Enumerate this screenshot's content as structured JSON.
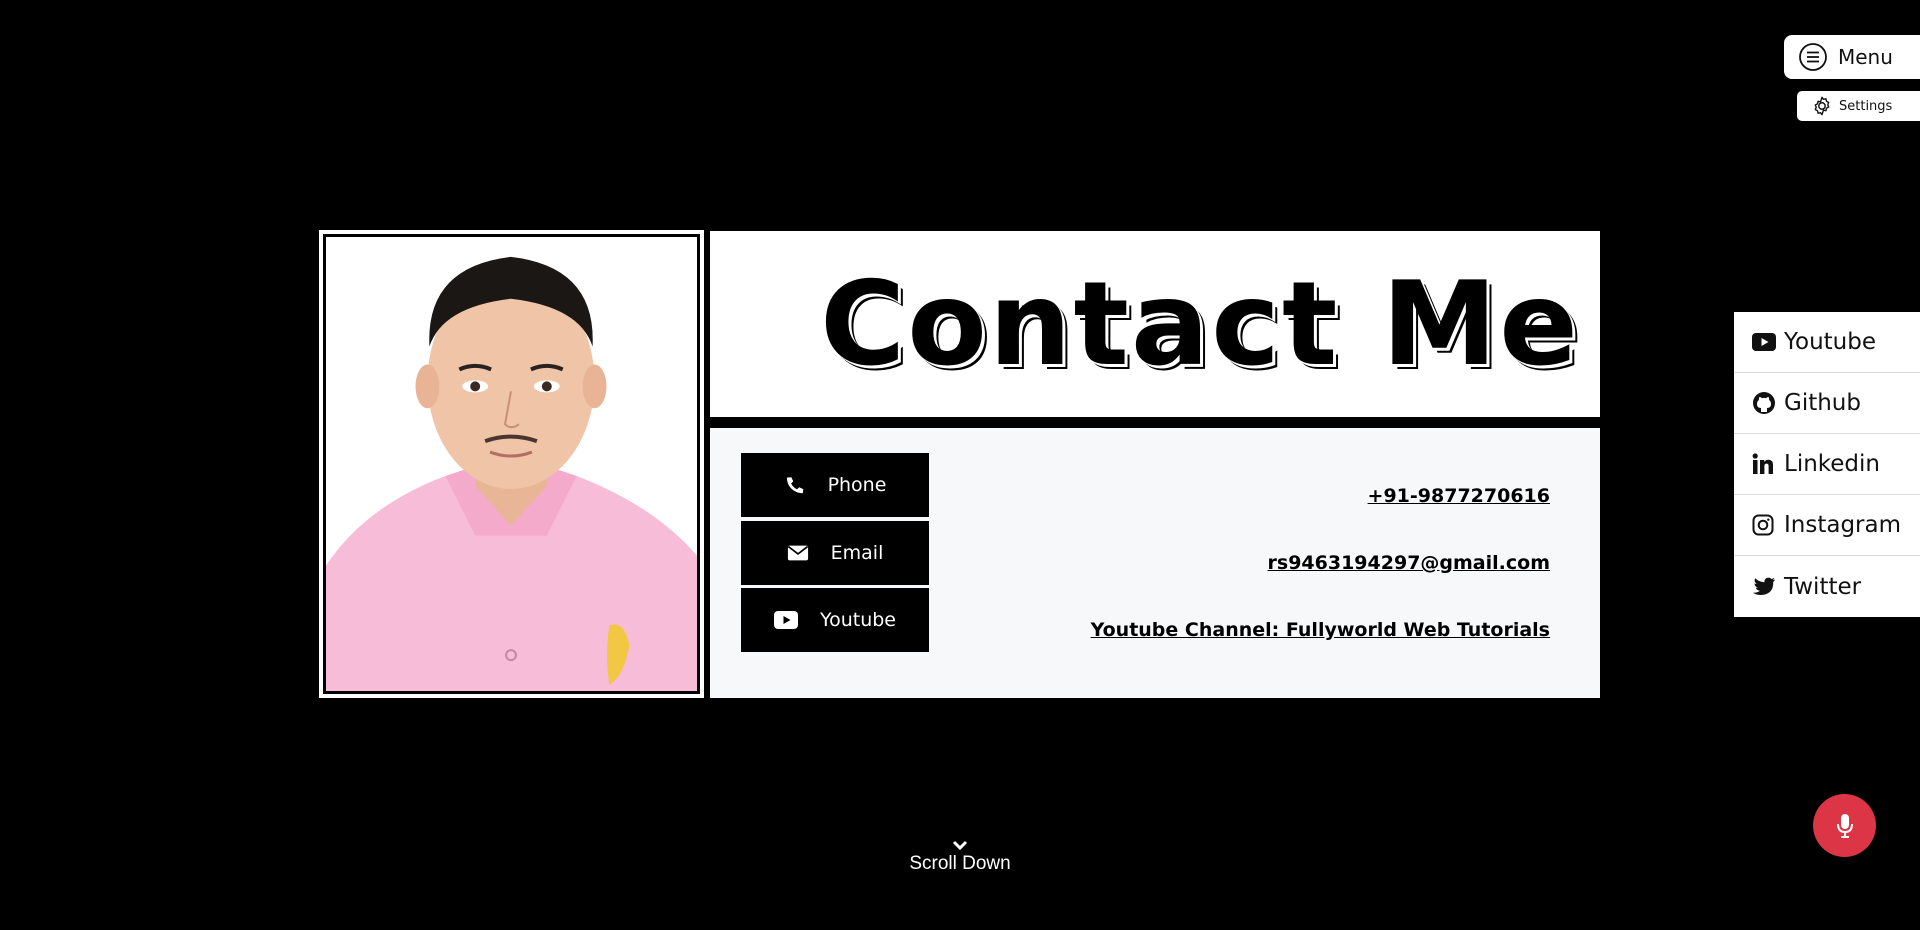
{
  "top_menu": {
    "menu_label": "Menu",
    "settings_label": "Settings"
  },
  "hero": {
    "title": "Contact Me"
  },
  "contact": {
    "buttons": [
      {
        "label": "Phone",
        "icon": "phone-icon"
      },
      {
        "label": "Email",
        "icon": "envelope-icon"
      },
      {
        "label": "Youtube",
        "icon": "youtube-icon"
      }
    ],
    "links": [
      "+91-9877270616",
      "rs9463194297@gmail.com",
      "Youtube Channel: Fullyworld Web Tutorials"
    ]
  },
  "social": [
    {
      "label": "Youtube",
      "icon": "youtube-icon"
    },
    {
      "label": "Github",
      "icon": "github-icon"
    },
    {
      "label": "Linkedin",
      "icon": "linkedin-icon"
    },
    {
      "label": "Instagram",
      "icon": "instagram-icon"
    },
    {
      "label": "Twitter",
      "icon": "twitter-icon"
    }
  ],
  "scroll": {
    "label": "Scroll Down"
  },
  "colors": {
    "background": "#000000",
    "panel": "#ffffff",
    "contact_panel": "#f7f8fa",
    "mic_button": "#dc3545",
    "shirt": "#f6bcd8"
  }
}
